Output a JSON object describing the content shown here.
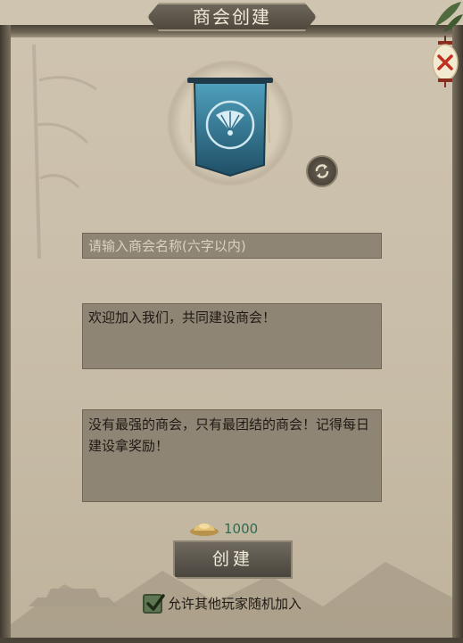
{
  "dialog": {
    "title": "商会创建"
  },
  "form": {
    "name_placeholder": "请输入商会名称(六字以内)",
    "name_value": "",
    "slogan": "欢迎加入我们，共同建设商会！",
    "notice": "没有最强的商会，只有最团结的商会！记得每日建设拿奖励！"
  },
  "cost": {
    "currency_icon": "gold-ingot-icon",
    "value": "1000"
  },
  "actions": {
    "create_label": "创建"
  },
  "options": {
    "allow_random_join_label": "允许其他玩家随机加入",
    "allow_random_join_checked": true
  },
  "colors": {
    "panel_bg": "#c8bda8",
    "frame": "#4b4438",
    "field_bg": "#8f8574",
    "cost_text": "#2e6a50",
    "banner_blue": "#2f6f8a",
    "checkbox_green": "#5d7550"
  }
}
